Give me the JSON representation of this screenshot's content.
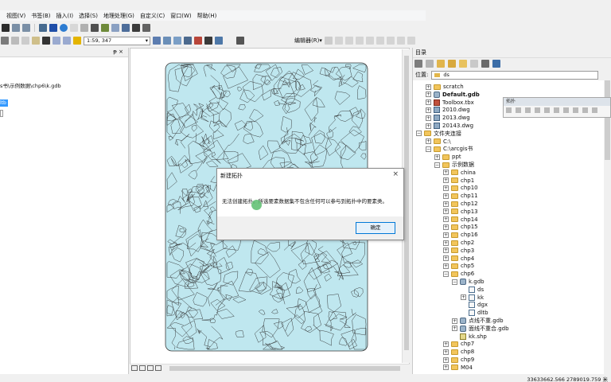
{
  "menu": {
    "items": [
      "视图(V)",
      "书签(B)",
      "插入(I)",
      "选择(S)",
      "地理处理(G)",
      "自定义(C)",
      "窗口(W)",
      "帮助(H)"
    ]
  },
  "toolbar": {
    "scale_value": "1:59, 347",
    "editor_label": "编辑器(R)▾"
  },
  "toc": {
    "path_text": "s书\\示例数据\\chp6\\k.gdb",
    "selected_text": "ltb",
    "pin_label": "ᵽ ×"
  },
  "catalog": {
    "title": "目录",
    "location_label": "位置:",
    "location_value": "ds",
    "tree": [
      {
        "text": "scratch",
        "icon": "folder-icon",
        "indent": 0,
        "exp": "+"
      },
      {
        "text": "Default.gdb",
        "icon": "gdb-icon",
        "indent": 0,
        "exp": "+",
        "bold": true
      },
      {
        "text": "Toolbox.tbx",
        "icon": "toolbox-icon",
        "indent": 0,
        "exp": "+"
      },
      {
        "text": "2010.dwg",
        "icon": "dwg-icon",
        "indent": 0,
        "exp": "+"
      },
      {
        "text": "2013.dwg",
        "icon": "dwg-icon",
        "indent": 0,
        "exp": "+"
      },
      {
        "text": "20143.dwg",
        "icon": "dwg-icon",
        "indent": 0,
        "exp": "+"
      },
      {
        "text": "文件夹连接",
        "icon": "folder-icon",
        "indent": -1,
        "exp": "−"
      },
      {
        "text": "C:\\",
        "icon": "folder-icon",
        "indent": 0,
        "exp": "+"
      },
      {
        "text": "C:\\arcgis书",
        "icon": "folder-icon",
        "indent": 0,
        "exp": "−"
      },
      {
        "text": "ppt",
        "icon": "folder-icon",
        "indent": 1,
        "exp": "+"
      },
      {
        "text": "示例数据",
        "icon": "folder-icon",
        "indent": 1,
        "exp": "−"
      },
      {
        "text": "china",
        "icon": "folder-icon",
        "indent": 2,
        "exp": "+"
      },
      {
        "text": "chp1",
        "icon": "folder-icon",
        "indent": 2,
        "exp": "+"
      },
      {
        "text": "chp10",
        "icon": "folder-icon",
        "indent": 2,
        "exp": "+"
      },
      {
        "text": "chp11",
        "icon": "folder-icon",
        "indent": 2,
        "exp": "+"
      },
      {
        "text": "chp12",
        "icon": "folder-icon",
        "indent": 2,
        "exp": "+"
      },
      {
        "text": "chp13",
        "icon": "folder-icon",
        "indent": 2,
        "exp": "+"
      },
      {
        "text": "chp14",
        "icon": "folder-icon",
        "indent": 2,
        "exp": "+"
      },
      {
        "text": "chp15",
        "icon": "folder-icon",
        "indent": 2,
        "exp": "+"
      },
      {
        "text": "chp16",
        "icon": "folder-icon",
        "indent": 2,
        "exp": "+"
      },
      {
        "text": "chp2",
        "icon": "folder-icon",
        "indent": 2,
        "exp": "+"
      },
      {
        "text": "chp3",
        "icon": "folder-icon",
        "indent": 2,
        "exp": "+"
      },
      {
        "text": "chp4",
        "icon": "folder-icon",
        "indent": 2,
        "exp": "+"
      },
      {
        "text": "chp5",
        "icon": "folder-icon",
        "indent": 2,
        "exp": "+"
      },
      {
        "text": "chp6",
        "icon": "folder-icon",
        "indent": 2,
        "exp": "−"
      },
      {
        "text": "k.gdb",
        "icon": "gdb-icon",
        "indent": 3,
        "exp": "−"
      },
      {
        "text": "ds",
        "icon": "feature-dataset-icon",
        "indent": 4,
        "exp": ""
      },
      {
        "text": "kk",
        "icon": "feature-dataset-icon",
        "indent": 4,
        "exp": "+"
      },
      {
        "text": "dgx",
        "icon": "feature-class-icon",
        "indent": 4,
        "exp": ""
      },
      {
        "text": "dltb",
        "icon": "feature-class-icon",
        "indent": 4,
        "exp": ""
      },
      {
        "text": "点线不重.gdb",
        "icon": "gdb-icon",
        "indent": 3,
        "exp": "+"
      },
      {
        "text": "面线不重合.gdb",
        "icon": "gdb-icon",
        "indent": 3,
        "exp": "+"
      },
      {
        "text": "kk.shp",
        "icon": "shapefile-icon",
        "indent": 3,
        "exp": ""
      },
      {
        "text": "chp7",
        "icon": "folder-icon",
        "indent": 2,
        "exp": "+"
      },
      {
        "text": "chp8",
        "icon": "folder-icon",
        "indent": 2,
        "exp": "+"
      },
      {
        "text": "chp9",
        "icon": "folder-icon",
        "indent": 2,
        "exp": "+"
      },
      {
        "text": "M04",
        "icon": "folder-icon",
        "indent": 2,
        "exp": "+"
      }
    ]
  },
  "topology_toolbar": {
    "title": "拓扑"
  },
  "dialog": {
    "title": "新建拓扑",
    "message": "无法创建拓扑。所选要素数据集不包含任何可以参与到拓扑中的要素类。",
    "ok_label": "确定",
    "close_label": "×"
  },
  "status": {
    "coords": "33633662.566  2789019.759 米"
  },
  "colors": {
    "map_fill": "#bfe7ef",
    "map_stroke": "#3a3a3a",
    "selection": "#3399ff",
    "ok_border": "#0078d7"
  }
}
